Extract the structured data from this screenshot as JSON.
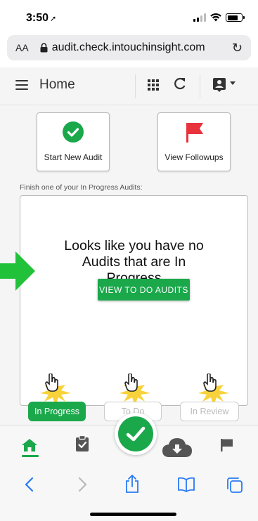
{
  "status_bar": {
    "time": "3:50",
    "location_arrow": "➚"
  },
  "browser": {
    "text_size_label": "AA",
    "url": "audit.check.intouchinsight.com",
    "reload_glyph": "↻"
  },
  "header": {
    "title": "Home"
  },
  "actions": {
    "start_audit_label": "Start New Audit",
    "view_followups_label": "View Followups"
  },
  "in_progress": {
    "prompt": "Finish one of your In Progress Audits:",
    "empty_message": "Looks like you have no Audits that are In Progress",
    "view_todo_label": "VIEW TO DO AUDITS"
  },
  "tabs": [
    {
      "label": "In Progress",
      "active": true
    },
    {
      "label": "To Do",
      "active": false
    },
    {
      "label": "In Review",
      "active": false
    }
  ],
  "colors": {
    "accent": "#1aa84b",
    "flag": "#e8323c",
    "arrow": "#22c13a",
    "burst": "#f7d23a"
  }
}
